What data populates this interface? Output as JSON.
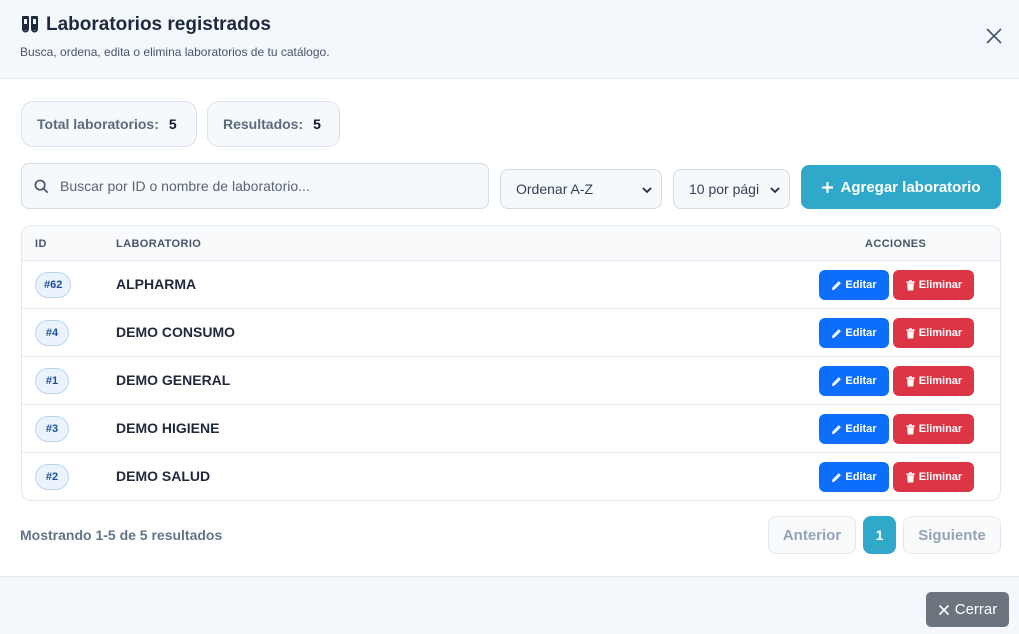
{
  "header": {
    "title": "Laboratorios registrados",
    "subtitle": "Busca, ordena, edita o elimina laboratorios de tu catálogo."
  },
  "stats": {
    "total_label": "Total laboratorios:",
    "total_value": "5",
    "results_label": "Resultados:",
    "results_value": "5"
  },
  "toolbar": {
    "search_placeholder": "Buscar por ID o nombre de laboratorio...",
    "search_value": "",
    "order_selected": "Ordenar A-Z",
    "per_page_selected": "10 por pági",
    "add_label": "Agregar laboratorio"
  },
  "table": {
    "headers": {
      "id": "ID",
      "lab": "LABORATORIO",
      "actions": "ACCIONES"
    },
    "rows": [
      {
        "id": "#62",
        "name": "ALPHARMA"
      },
      {
        "id": "#4",
        "name": "DEMO CONSUMO"
      },
      {
        "id": "#1",
        "name": "DEMO GENERAL"
      },
      {
        "id": "#3",
        "name": "DEMO HIGIENE"
      },
      {
        "id": "#2",
        "name": "DEMO SALUD"
      }
    ],
    "edit_label": "Editar",
    "delete_label": "Eliminar"
  },
  "pagination": {
    "showing": "Mostrando 1-5 de 5 resultados",
    "prev": "Anterior",
    "current": "1",
    "next": "Siguiente"
  },
  "footer": {
    "close_label": "Cerrar"
  },
  "colors": {
    "accent": "#30a8c9",
    "edit": "#0d6efd",
    "delete": "#dc3545",
    "close": "#6c757d"
  },
  "icons": {
    "title": "test-tubes-icon",
    "close": "close-icon",
    "search": "search-icon",
    "add": "plus-icon",
    "edit": "pencil-icon",
    "delete": "trash-icon"
  }
}
